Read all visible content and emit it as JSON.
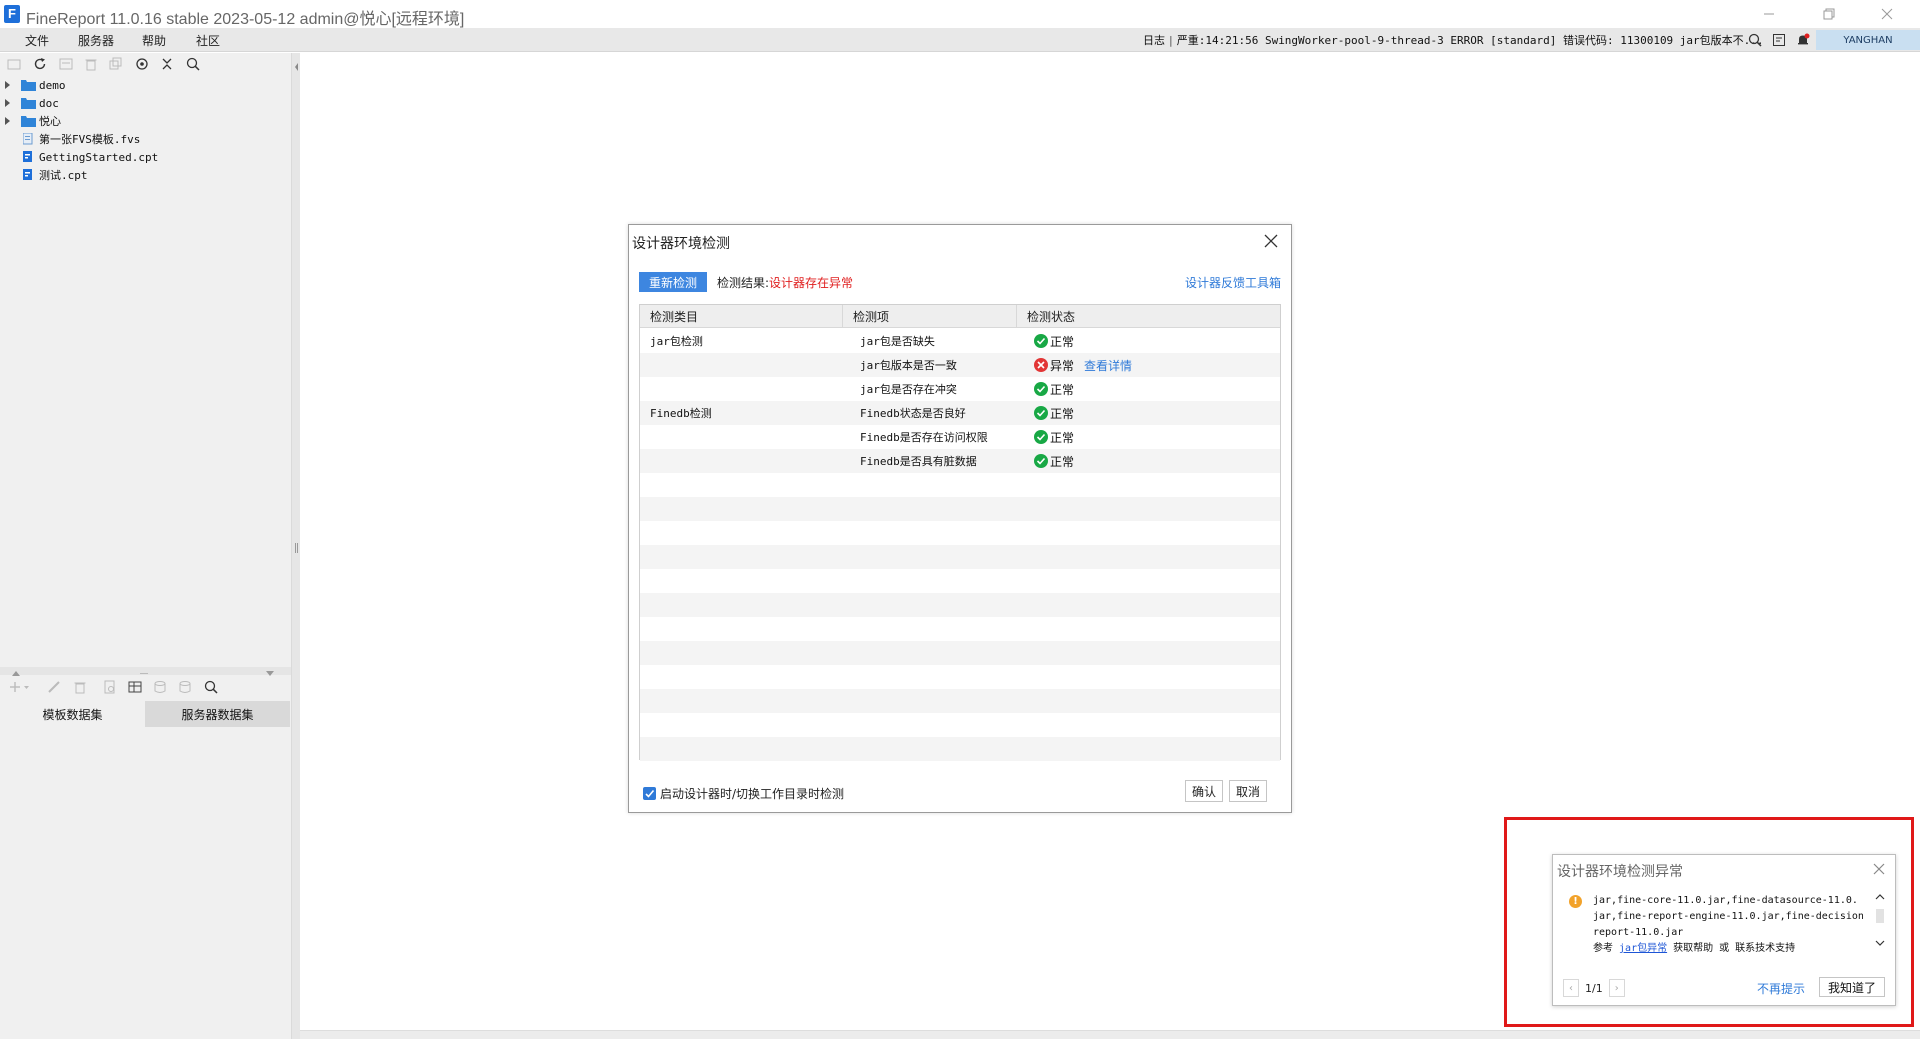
{
  "app": {
    "title": "FineReport 11.0.16 stable 2023-05-12 admin@悦心[远程环境]",
    "logo_letter": "F"
  },
  "menu": {
    "file": "文件",
    "server": "服务器",
    "help": "帮助",
    "community": "社区"
  },
  "status": {
    "log_label": "日志",
    "log_message": "严重:14:21:56 SwingWorker-pool-9-thread-3 ERROR [standard] 错误代码: 11300109 jar包版本不...",
    "user": "YANGHAN"
  },
  "file_tree": {
    "items": [
      {
        "label": "demo",
        "type": "folder"
      },
      {
        "label": "doc",
        "type": "folder"
      },
      {
        "label": "悦心",
        "type": "folder"
      },
      {
        "label": "第一张FVS模板.fvs",
        "type": "fvs"
      },
      {
        "label": "GettingStarted.cpt",
        "type": "cpt"
      },
      {
        "label": "测试.cpt",
        "type": "cpt"
      }
    ]
  },
  "dataset_tabs": {
    "template": "模板数据集",
    "server": "服务器数据集"
  },
  "dialog": {
    "title": "设计器环境检测",
    "recheck_label": "重新检测",
    "result_label": "检测结果:",
    "result_value": "设计器存在异常",
    "toolbox_link": "设计器反馈工具箱",
    "columns": [
      "检测类目",
      "检测项",
      "检测状态"
    ],
    "rows": [
      {
        "category": "jar包检测",
        "item": "jar包是否缺失",
        "status": "正常",
        "state": "ok",
        "link": ""
      },
      {
        "category": "",
        "item": "jar包版本是否一致",
        "status": "异常",
        "state": "error",
        "link": "查看详情"
      },
      {
        "category": "",
        "item": "jar包是否存在冲突",
        "status": "正常",
        "state": "ok",
        "link": ""
      },
      {
        "category": "Finedb检测",
        "item": "Finedb状态是否良好",
        "status": "正常",
        "state": "ok",
        "link": ""
      },
      {
        "category": "",
        "item": "Finedb是否存在访问权限",
        "status": "正常",
        "state": "ok",
        "link": ""
      },
      {
        "category": "",
        "item": "Finedb是否具有脏数据",
        "status": "正常",
        "state": "ok",
        "link": ""
      }
    ],
    "auto_check_label": "启动设计器时/切换工作目录时检测",
    "confirm_label": "确认",
    "cancel_label": "取消"
  },
  "notification": {
    "title": "设计器环境检测异常",
    "line1": "jar,fine-core-11.0.jar,fine-datasource-11.0.",
    "line2": "jar,fine-report-engine-11.0.jar,fine-decision-",
    "line3": "report-11.0.jar",
    "ref_prefix": "参考",
    "ref_link": "jar包异常",
    "ref_suffix": "获取帮助 或 联系技术支持",
    "pager": "1/1",
    "dont_show": "不再提示",
    "got_it": "我知道了"
  },
  "colors": {
    "accent": "#3d86e0",
    "error_red": "#e02020",
    "ok_green": "#18a845",
    "highlight_red": "#e01818"
  }
}
